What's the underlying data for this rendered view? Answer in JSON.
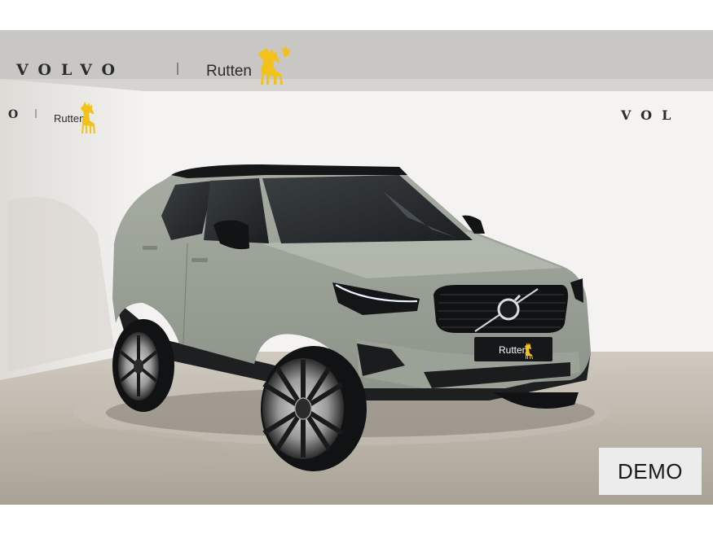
{
  "photo": {
    "description_alt": "Volvo XC40 at Rutten showroom",
    "brand_wordmark": "VOLVO",
    "dealer_name": "Rutten",
    "side_wall_brand_partial": "O",
    "side_wall_dealer": "Rutten",
    "right_wall_brand_partial": "VOL",
    "plate_text": "Rutten",
    "colors": {
      "car_body": "#9aa196",
      "wall": "#f3f2f0",
      "floor": "#b9b3a8",
      "logo_yellow": "#f2c21b"
    }
  },
  "badge": {
    "label": "DEMO"
  }
}
